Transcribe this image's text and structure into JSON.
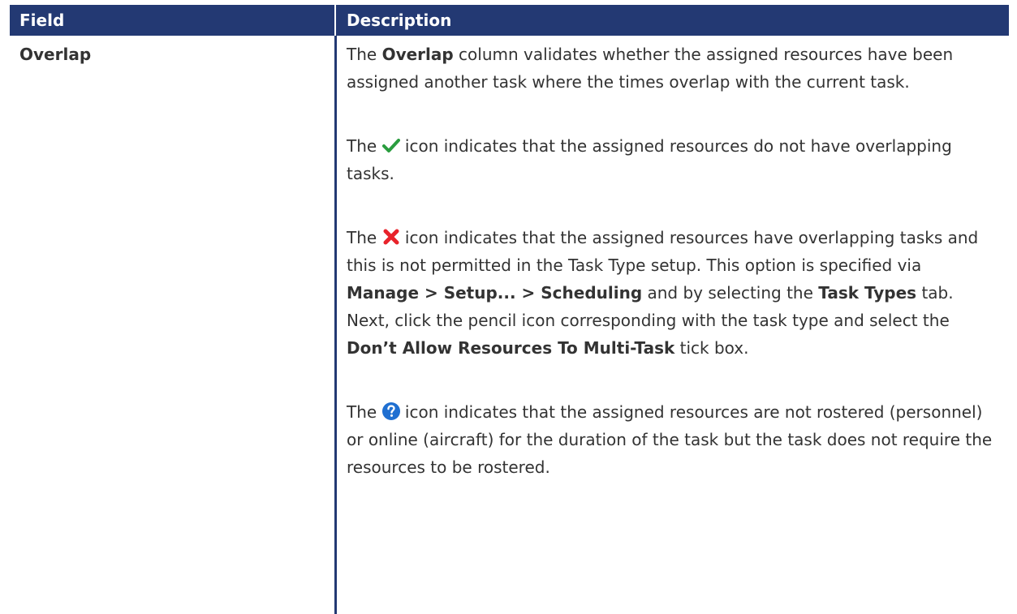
{
  "colors": {
    "header_bg": "#233973",
    "check": "#2a9d3f",
    "cross": "#e8232b",
    "question": "#1f6fd1"
  },
  "header": {
    "field": "Field",
    "description": "Description"
  },
  "row": {
    "field": "Overlap",
    "p1": {
      "t1": "The ",
      "b1": "Overlap",
      "t2": " column validates whether the assigned resources have been assigned another task where the times overlap with the current task."
    },
    "p2": {
      "t1": "The ",
      "icon": "check-icon",
      "t2": " icon indicates that the assigned resources do not have overlapping tasks."
    },
    "p3": {
      "t1": "The ",
      "icon": "cross-icon",
      "t2": " icon indicates that the assigned resources have overlapping tasks and this is not permitted in the Task Type setup. This option is specified via ",
      "b1": "Manage > Setup... > Scheduling",
      "t3": " and by selecting the ",
      "b2": "Task Types",
      "t4": " tab. Next, click the pencil icon corresponding with the task type and select the ",
      "b3": "Don’t Allow Resources To Multi-Task",
      "t5": " tick box."
    },
    "p4": {
      "t1": "The ",
      "icon": "question-icon",
      "t2": " icon indicates that the assigned resources are not rostered (personnel) or online (aircraft) for the duration of the task but the task does not require the resources to be rostered."
    }
  }
}
